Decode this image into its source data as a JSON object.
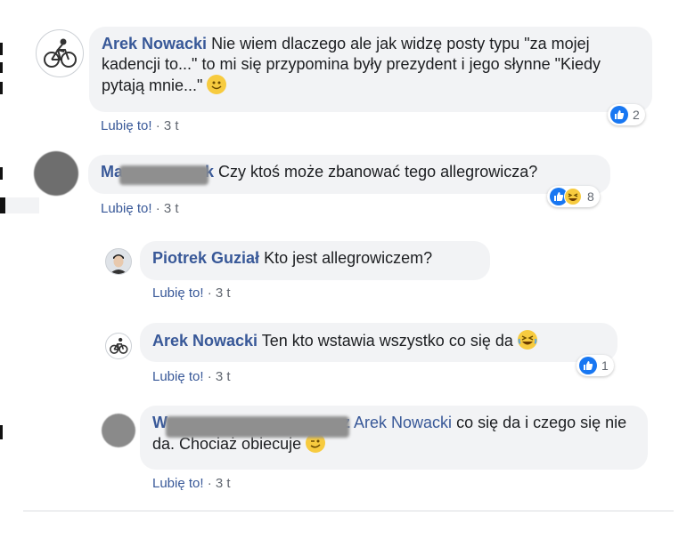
{
  "comments": [
    {
      "author": "Arek Nowacki",
      "text": "Nie wiem dlaczego ale jak widzę posty typu \"za mojej kadencji to...\" to mi się przypomina były prezydent i jego słynne \"Kiedy pytają mnie...\"",
      "emoji": "smile-emoji",
      "like_label": "Lubię to!",
      "time": "· 3 t",
      "reaction_count": "2"
    },
    {
      "author_prefix": "Ma",
      "author_suffix": "k",
      "text": "Czy ktoś może zbanować tego allegrowicza?",
      "like_label": "Lubię to!",
      "time": "· 3 t",
      "reaction_count": "8"
    },
    {
      "author": "Piotrek Guział",
      "text": "Kto jest allegrowiczem?",
      "like_label": "Lubię to!",
      "time": "· 3 t"
    },
    {
      "author": "Arek Nowacki",
      "text": "Ten kto wstawia wszystko co się da",
      "emoji": "laughing-emoji",
      "like_label": "Lubię to!",
      "time": "· 3 t",
      "reaction_count": "1"
    },
    {
      "author_prefix": "W",
      "author_suffix": "z",
      "mention": "Arek Nowacki",
      "text": "co się da i czego się nie da. Chociaż obiecuje",
      "emoji": "wink-emoji",
      "like_label": "Lubię to!",
      "time": "· 3 t"
    }
  ],
  "colors": {
    "link": "#385898",
    "bubble": "#f2f3f5",
    "like_blue": "#1877f2"
  }
}
